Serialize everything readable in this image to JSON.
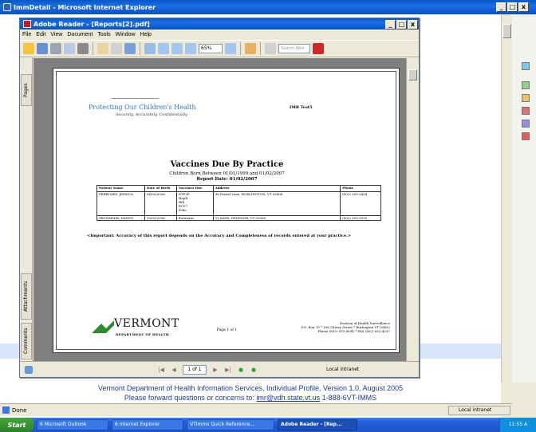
{
  "ie": {
    "title": "ImmDetail - Microsoft Internet Explorer",
    "footer_line1": "Vermont Department of Health Information Services, Individual Profile, Version 1.0, August 2005",
    "footer_line2_prefix": "Please forward questions or concerns to: ",
    "footer_email": "imr@vdh.state.vt.us",
    "footer_line2_suffix": " 1-888-6VT-IMMS",
    "status_text": "Done",
    "zone": "Local intranet"
  },
  "reader": {
    "title": "Adobe Reader - [Reports[2].pdf]",
    "menu": [
      "File",
      "Edit",
      "View",
      "Document",
      "Tools",
      "Window",
      "Help"
    ],
    "zoom": "65%",
    "search_placeholder": "Search Web",
    "nav_tabs": [
      "Pages",
      "Attachments",
      "Comments"
    ],
    "page_indicator": "1 of 1",
    "status_zone": "Local intranet"
  },
  "pdf": {
    "logo_brand": "Protecting Our Children's Health",
    "logo_tagline": "Securely, Accurately, Confidentially",
    "imr_label": "IMR Test5",
    "report_title": "Vaccines Due By Practice",
    "report_subtitle": "Children Born Between 01/01/1999 and 01/02/2007",
    "report_date": "Report Date: 01/02/2007",
    "columns": [
      "Patient Name",
      "Date of Birth",
      "Vaccines Due",
      "Address",
      "Phone"
    ],
    "rows": [
      {
        "name": "FEBRUARY, JESSICA",
        "dob": "04/05/2006",
        "vaccines": "DTP-IP\nHepB\nHib\nPCV7\nPolio",
        "address": "98 Pernel Lane, BURLINGTON, VT 05408",
        "phone": "(802) 555-5454"
      },
      {
        "name": "ZRCHMMIK, DANNY",
        "dob": "10/01/2006",
        "vaccines": "Rotavirus",
        "address": "11 KAYE, WINDSOR, VT 05089",
        "phone": "(802) 555-5555"
      }
    ],
    "important_note": "<Important: Accuracy of this report depends on the Accuracy and Completeness of records entered at your practice.>",
    "page_of": "Page 1 of 1",
    "state": "VERMONT",
    "dept": "DEPARTMENT OF HEALTH",
    "address_lines": [
      "Division of Health Surveillance",
      "P.O. Box 70 * 108 Cherry Street * Burlington VT 05402",
      "Phone (802) 951-4094 * FAX (802) 652-4257"
    ]
  },
  "taskbar": {
    "start": "Start",
    "tasks": [
      "6 Microsoft Outlook",
      "6 Internet Explorer",
      "VTImms Quick Reference...",
      "Adobe Reader - [Rep..."
    ],
    "clock": "11:55 A"
  }
}
